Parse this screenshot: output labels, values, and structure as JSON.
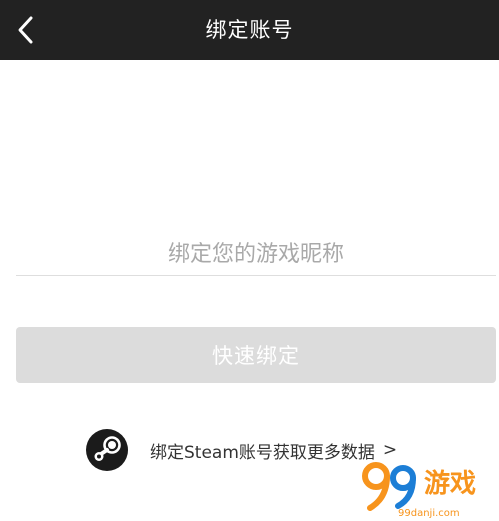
{
  "nav": {
    "title": "绑定账号",
    "back_icon": "chevron-left-icon"
  },
  "form": {
    "nickname_placeholder": "绑定您的游戏昵称",
    "nickname_value": "",
    "bind_button_label": "快速绑定"
  },
  "steam_link": {
    "icon": "steam-logo-icon",
    "label": "绑定Steam账号获取更多数据",
    "chevron": ">"
  },
  "watermark": {
    "brand": "99游戏",
    "site": "99danji.com"
  },
  "colors": {
    "nav_background": "#222222",
    "button_disabled": "#dcdcdc",
    "placeholder": "#a9a9a9",
    "watermark_orange": "#f7941d",
    "watermark_blue": "#1c7ed6"
  }
}
